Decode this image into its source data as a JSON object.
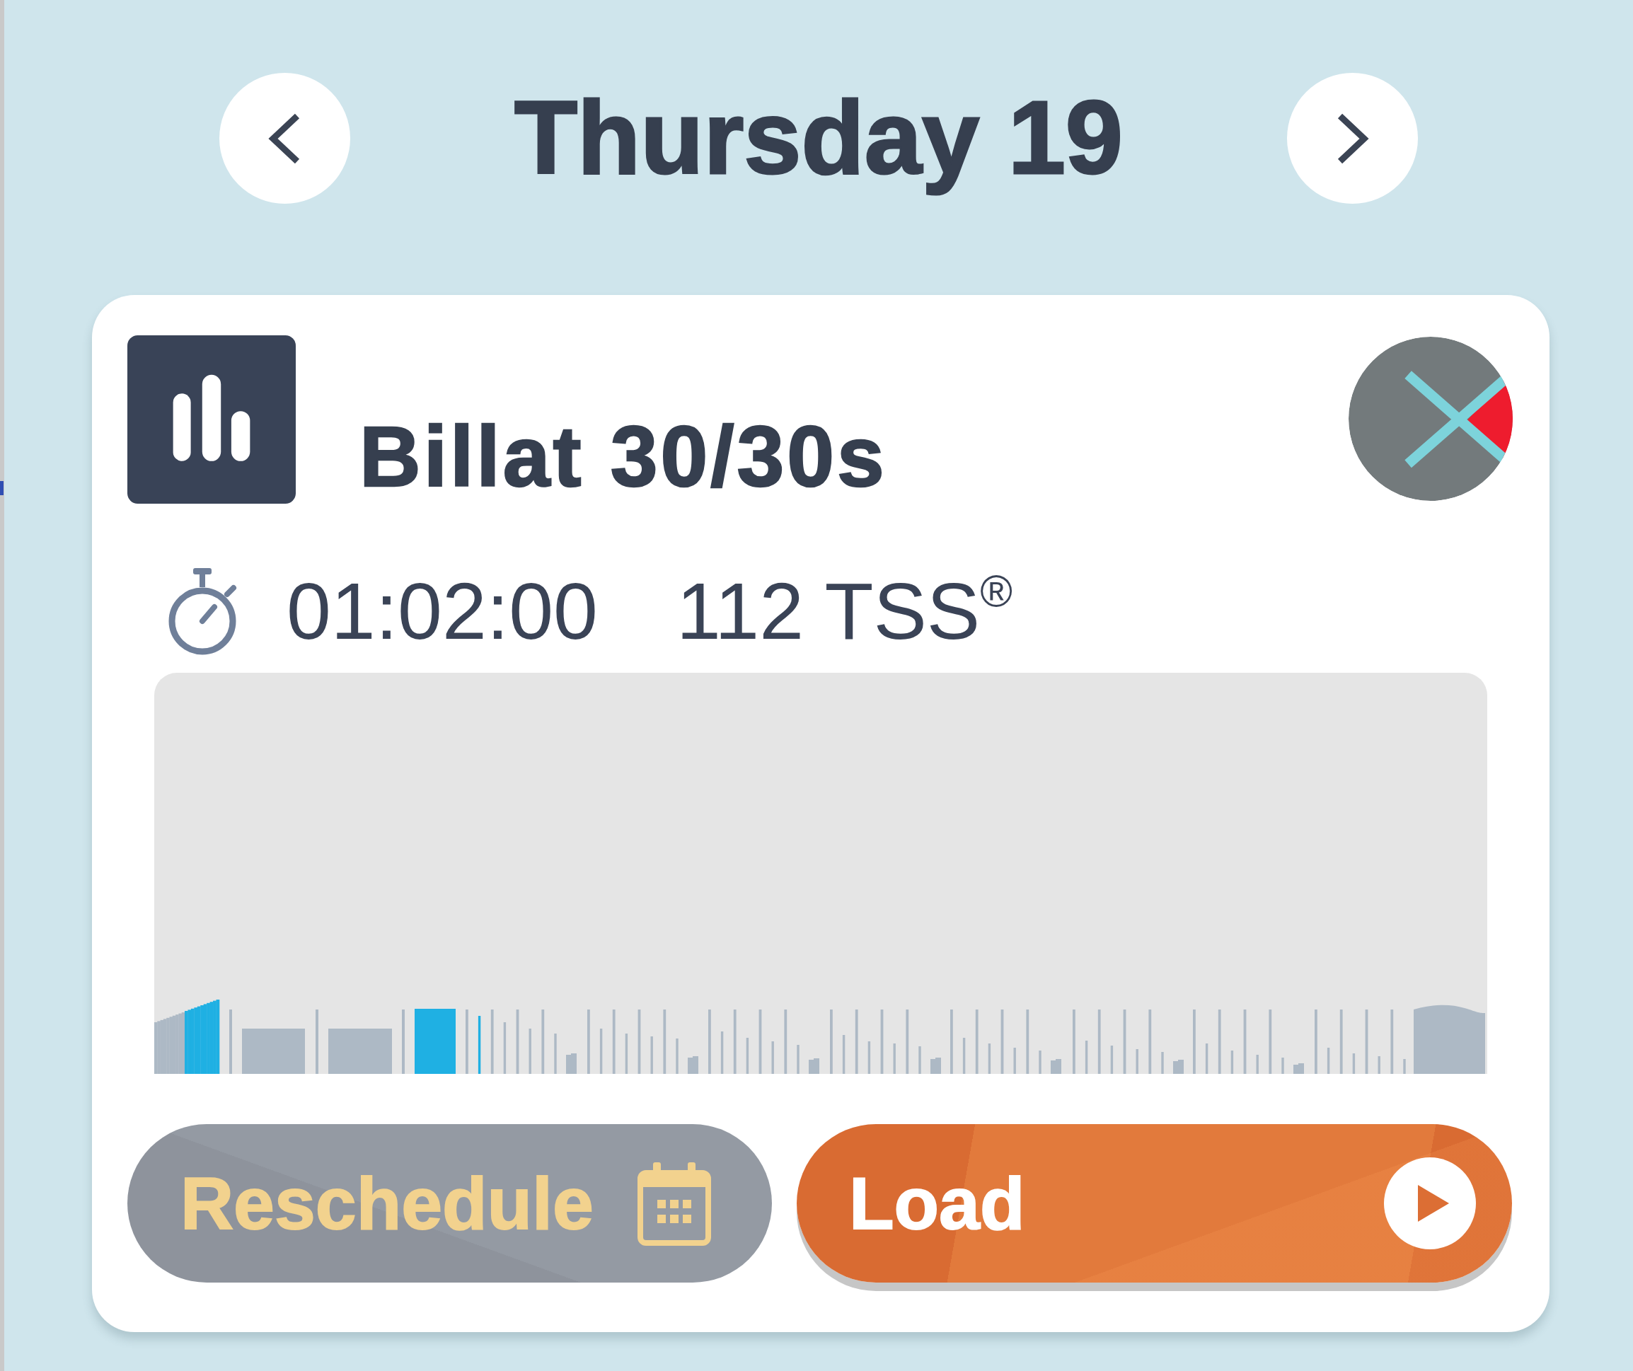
{
  "header": {
    "title": "Thursday 19"
  },
  "workout": {
    "title": "Billat 30/30s",
    "duration": "01:02:00",
    "tss": "112 TSS$^{®}$"
  },
  "actions": [
    {
      "kind": "reschedule",
      "label": "Reschedule",
      "disabled": true
    },
    {
      "kind": "load",
      "label": "Load",
      "disabled": false
    }
  ]
}
